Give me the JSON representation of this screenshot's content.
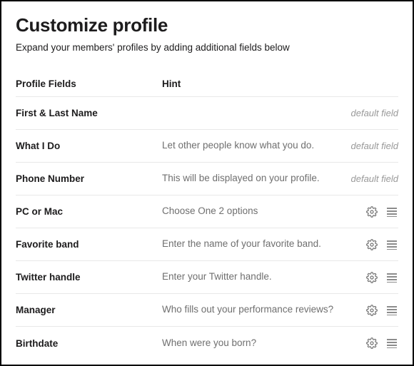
{
  "header": {
    "title": "Customize profile",
    "subtitle": "Expand your members' profiles by adding additional fields below"
  },
  "columns": {
    "name": "Profile Fields",
    "hint": "Hint"
  },
  "default_field_label": "default field",
  "fields": [
    {
      "name": "First & Last Name",
      "hint": "",
      "default": true
    },
    {
      "name": "What I Do",
      "hint": "Let other people know what you do.",
      "default": true
    },
    {
      "name": "Phone Number",
      "hint": "This will be displayed on your profile.",
      "default": true
    },
    {
      "name": "PC or Mac",
      "hint": "Choose One\n2 options",
      "default": false
    },
    {
      "name": "Favorite band",
      "hint": "Enter the name of your favorite band.",
      "default": false
    },
    {
      "name": "Twitter handle",
      "hint": "Enter your Twitter handle.",
      "default": false
    },
    {
      "name": "Manager",
      "hint": "Who fills out your performance reviews?",
      "default": false
    },
    {
      "name": "Birthdate",
      "hint": "When were you born?",
      "default": false
    }
  ]
}
